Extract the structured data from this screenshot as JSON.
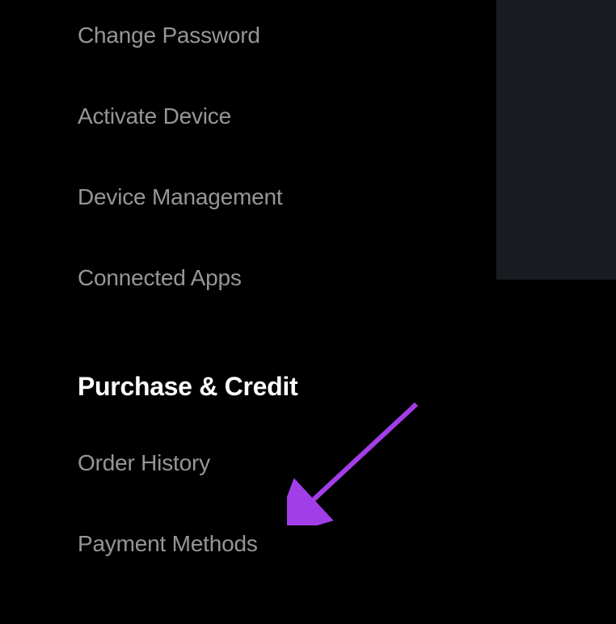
{
  "menu": {
    "items": [
      {
        "label": "Change Password"
      },
      {
        "label": "Activate Device"
      },
      {
        "label": "Device Management"
      },
      {
        "label": "Connected Apps"
      }
    ]
  },
  "section": {
    "heading": "Purchase & Credit",
    "items": [
      {
        "label": "Order History"
      },
      {
        "label": "Payment Methods"
      }
    ]
  },
  "annotation": {
    "arrow_color": "#a23ee8"
  }
}
